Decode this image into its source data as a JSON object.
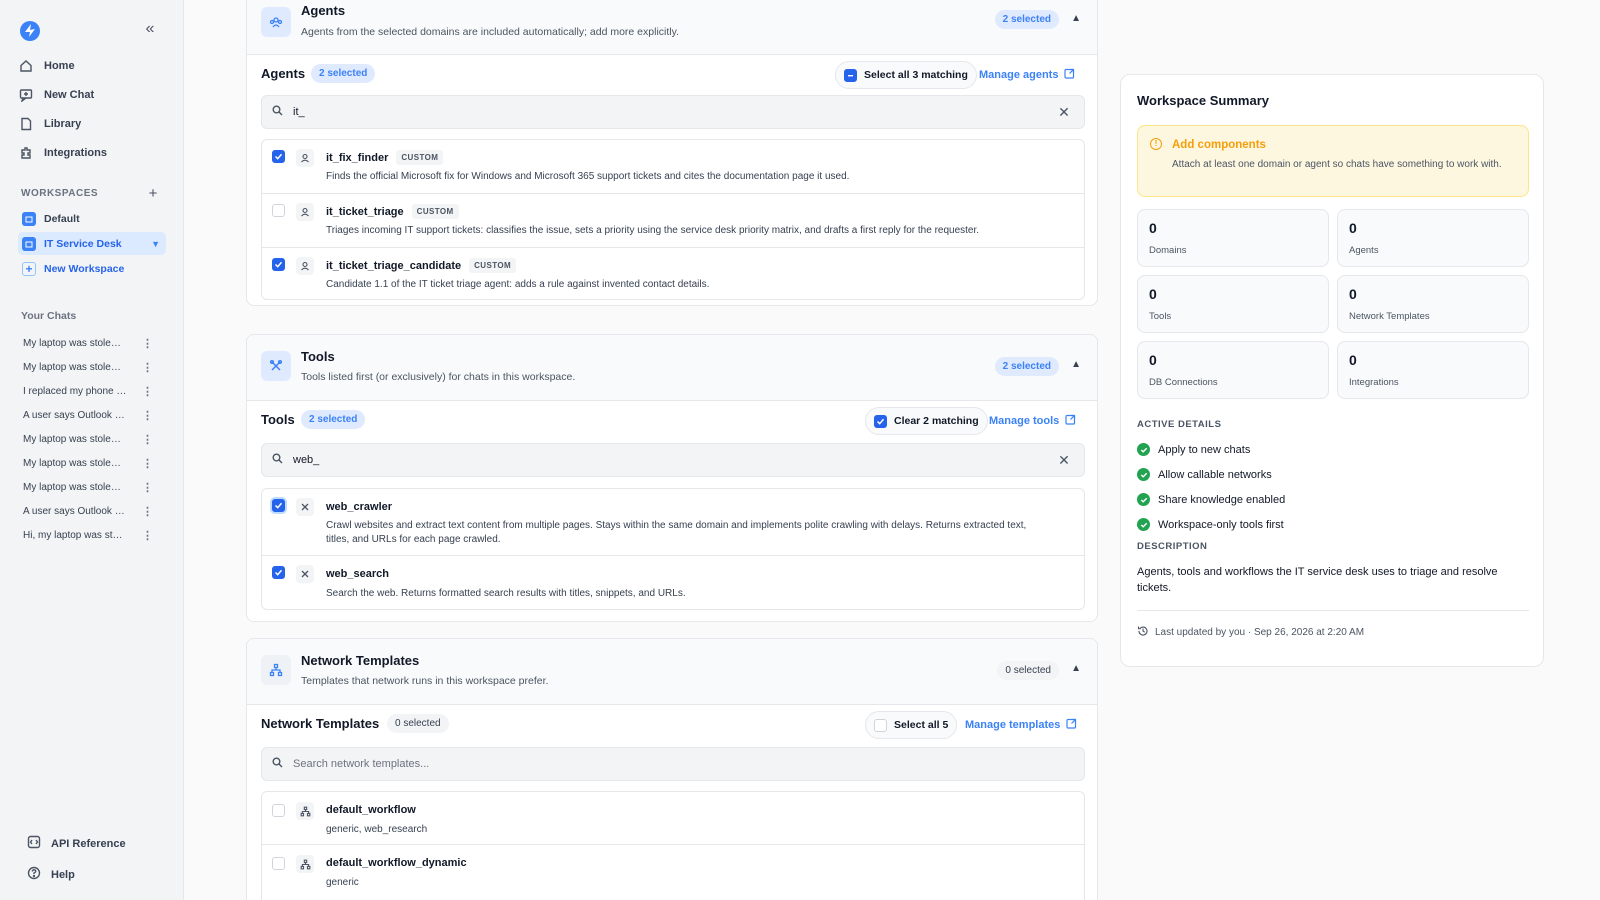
{
  "sidebar": {
    "nav": [
      {
        "label": "Home",
        "icon": "home-icon"
      },
      {
        "label": "New Chat",
        "icon": "new-chat-icon"
      },
      {
        "label": "Library",
        "icon": "library-icon"
      },
      {
        "label": "Integrations",
        "icon": "integrations-icon"
      }
    ],
    "workspaces_label": "WORKSPACES",
    "workspaces": [
      {
        "label": "Default",
        "active": false
      },
      {
        "label": "IT Service Desk",
        "active": true
      }
    ],
    "new_workspace_label": "New Workspace",
    "chats_label": "Your Chats",
    "chats": [
      "My laptop was stole…",
      "My laptop was stole…",
      "I replaced my phone …",
      "A user says Outlook …",
      "My laptop was stole…",
      "My laptop was stole…",
      "My laptop was stole…",
      "A user says Outlook …",
      "Hi, my laptop was st…"
    ],
    "api_reference_label": "API Reference",
    "help_label": "Help"
  },
  "agents": {
    "title": "Agents",
    "description": "Agents from the selected domains are included automatically; add more explicitly.",
    "selected_pill": "2 selected",
    "sub_title": "Agents",
    "sub_pill": "2 selected",
    "select_all_label": "Select all 3 matching",
    "manage_label": "Manage agents",
    "search_value": "it_",
    "items": [
      {
        "name": "it_fix_finder",
        "tag": "CUSTOM",
        "checked": true,
        "description": "Finds the official Microsoft fix for Windows and Microsoft 365 support tickets and cites the documentation page it used."
      },
      {
        "name": "it_ticket_triage",
        "tag": "CUSTOM",
        "checked": false,
        "description": "Triages incoming IT support tickets: classifies the issue, sets a priority using the service desk priority matrix, and drafts a first reply for the requester."
      },
      {
        "name": "it_ticket_triage_candidate",
        "tag": "CUSTOM",
        "checked": true,
        "description": "Candidate 1.1 of the IT ticket triage agent: adds a rule against invented contact details."
      }
    ]
  },
  "tools": {
    "title": "Tools",
    "description": "Tools listed first (or exclusively) for chats in this workspace.",
    "selected_pill": "2 selected",
    "sub_title": "Tools",
    "sub_pill": "2 selected",
    "clear_label": "Clear 2 matching",
    "manage_label": "Manage tools",
    "search_value": "web_",
    "items": [
      {
        "name": "web_crawler",
        "checked": true,
        "description": "Crawl websites and extract text content from multiple pages. Stays within the same domain and implements polite crawling with delays. Returns extracted text, titles, and URLs for each page crawled."
      },
      {
        "name": "web_search",
        "checked": true,
        "description": "Search the web. Returns formatted search results with titles, snippets, and URLs."
      }
    ]
  },
  "templates": {
    "title": "Network Templates",
    "description": "Templates that network runs in this workspace prefer.",
    "selected_pill": "0 selected",
    "sub_title": "Network Templates",
    "sub_pill": "0 selected",
    "select_all_label": "Select all 5",
    "manage_label": "Manage templates",
    "search_placeholder": "Search network templates...",
    "items": [
      {
        "name": "default_workflow",
        "checked": false,
        "description": "generic, web_research"
      },
      {
        "name": "default_workflow_dynamic",
        "checked": false,
        "description": "generic"
      }
    ]
  },
  "summary": {
    "title": "Workspace Summary",
    "alert_title": "Add components",
    "alert_text": "Attach at least one domain or agent so chats have something to work with.",
    "stats": [
      {
        "value": "0",
        "label": "Domains"
      },
      {
        "value": "0",
        "label": "Agents"
      },
      {
        "value": "0",
        "label": "Tools"
      },
      {
        "value": "0",
        "label": "Network Templates"
      },
      {
        "value": "0",
        "label": "DB Connections"
      },
      {
        "value": "0",
        "label": "Integrations"
      }
    ],
    "active_details_label": "ACTIVE DETAILS",
    "active_details": [
      "Apply to new chats",
      "Allow callable networks",
      "Share knowledge enabled",
      "Workspace-only tools first"
    ],
    "description_label": "DESCRIPTION",
    "description": "Agents, tools and workflows the IT service desk uses to triage and resolve tickets.",
    "updated": "Last updated by you · Sep 26, 2026 at 2:20 AM"
  },
  "colors": {
    "accent": "#2563eb",
    "warning": "#f59e0b",
    "success": "#22a352"
  }
}
